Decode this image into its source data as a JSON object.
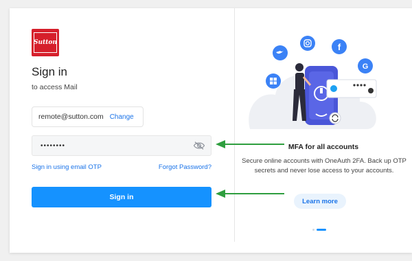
{
  "brand": {
    "logo_text": "Sutton",
    "color": "#d61f2b"
  },
  "signin": {
    "title": "Sign in",
    "subtitle": "to access Mail",
    "email": "remote@sutton.com",
    "change_label": "Change",
    "password_value": "••••••••",
    "email_otp_link": "Sign in using email OTP",
    "forgot_link": "Forgot Password?",
    "button_label": "Sign in",
    "accent_color": "#1592ff"
  },
  "promo": {
    "title": "MFA for all accounts",
    "description": "Secure online accounts with OneAuth 2FA. Back up OTP secrets and never lose access to your accounts.",
    "learn_more": "Learn more",
    "icons": [
      "instagram-icon",
      "twitter-icon",
      "facebook-icon",
      "google-icon",
      "microsoft-icon"
    ],
    "carousel": {
      "total": 2,
      "active": 2
    }
  },
  "annotation": {
    "arrow_color": "#2e9e3e"
  }
}
